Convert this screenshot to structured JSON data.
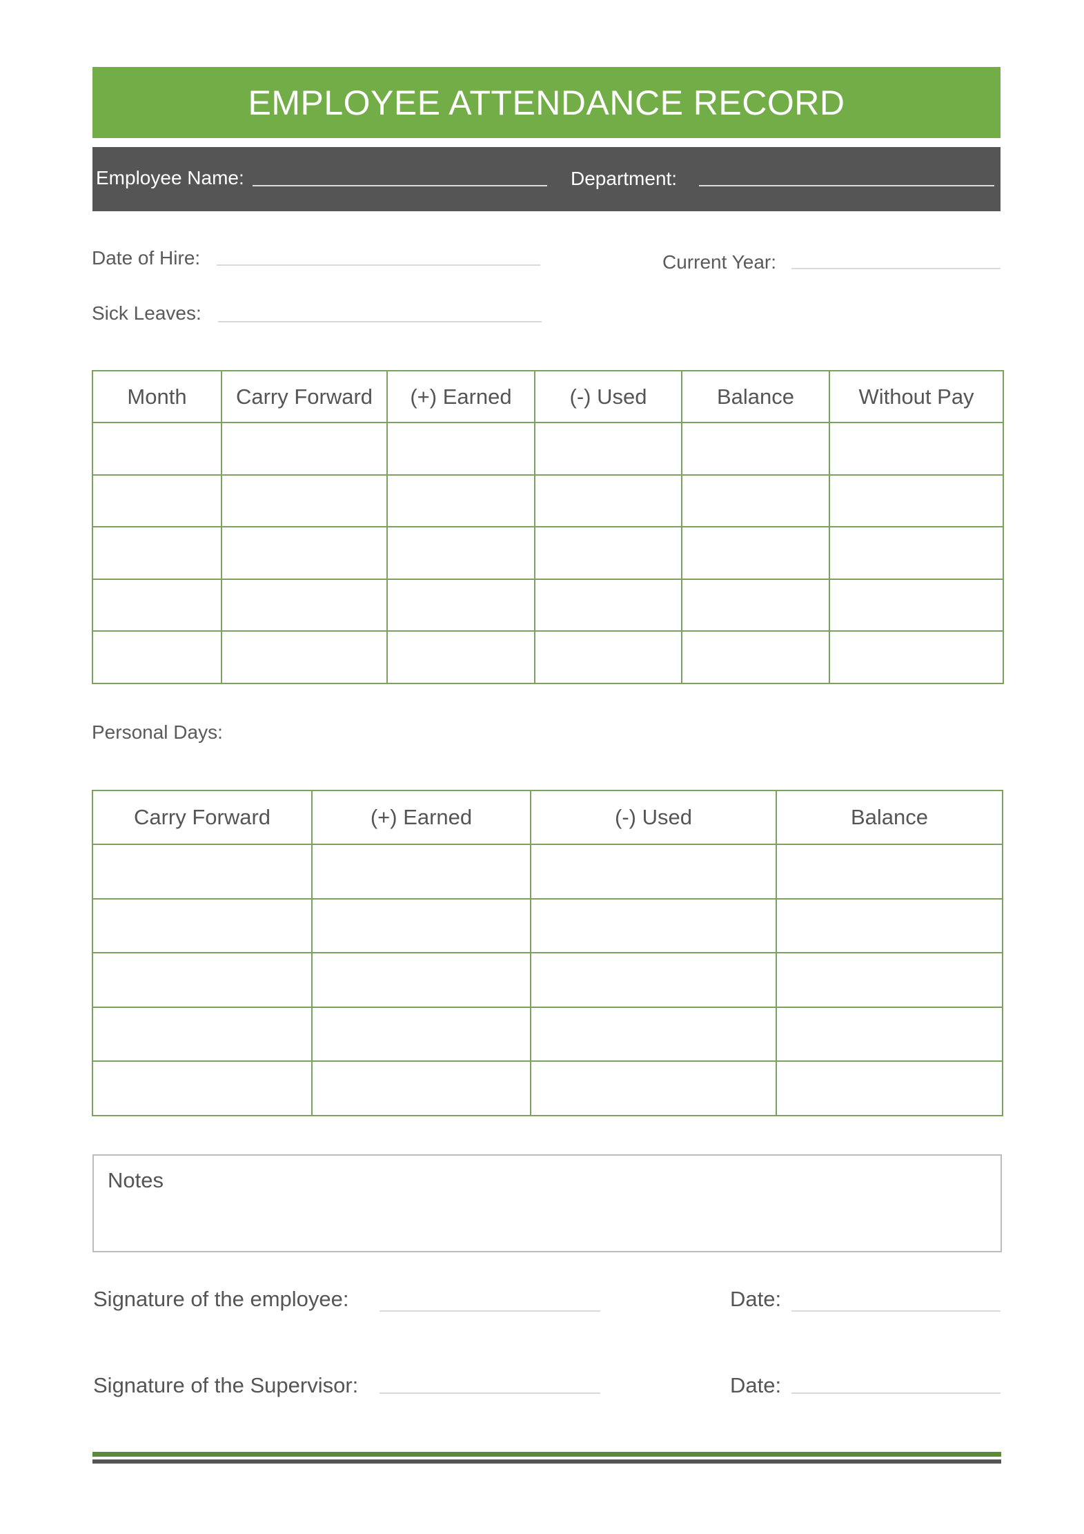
{
  "header": {
    "title": "EMPLOYEE ATTENDANCE RECORD",
    "employee_name_label": "Employee Name:",
    "department_label": "Department:"
  },
  "fields": {
    "date_of_hire_label": "Date of Hire:",
    "current_year_label": "Current Year:",
    "sick_leaves_label": "Sick Leaves:"
  },
  "sick_leave_table": {
    "columns": [
      "Month",
      "Carry Forward",
      "(+) Earned",
      "(-) Used",
      "Balance",
      "Without Pay"
    ],
    "rows": [
      [
        "",
        "",
        "",
        "",
        "",
        ""
      ],
      [
        "",
        "",
        "",
        "",
        "",
        ""
      ],
      [
        "",
        "",
        "",
        "",
        "",
        ""
      ],
      [
        "",
        "",
        "",
        "",
        "",
        ""
      ],
      [
        "",
        "",
        "",
        "",
        "",
        ""
      ]
    ]
  },
  "personal_days": {
    "label": "Personal Days:",
    "columns": [
      "Carry Forward",
      "(+) Earned",
      "(-) Used",
      "Balance"
    ],
    "rows": [
      [
        "",
        "",
        "",
        ""
      ],
      [
        "",
        "",
        "",
        ""
      ],
      [
        "",
        "",
        "",
        ""
      ],
      [
        "",
        "",
        "",
        ""
      ],
      [
        "",
        "",
        "",
        ""
      ]
    ]
  },
  "notes": {
    "label": "Notes",
    "value": ""
  },
  "signatures": {
    "employee_label": "Signature of the employee:",
    "supervisor_label": "Signature of the Supervisor:",
    "date_label": "Date:"
  },
  "colors": {
    "accent_green": "#72ad48",
    "dark_gray": "#555555",
    "table_border": "#7aa25e"
  }
}
